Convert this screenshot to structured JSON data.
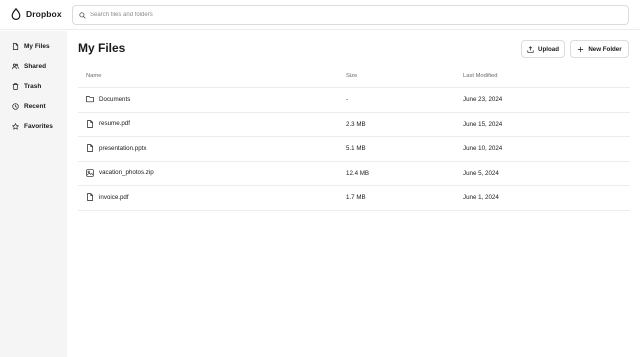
{
  "app": {
    "name": "Dropbox"
  },
  "search": {
    "placeholder": "Search files and folders",
    "value": ""
  },
  "sidebar": {
    "items": [
      {
        "label": "My Files",
        "icon": "file-icon"
      },
      {
        "label": "Shared",
        "icon": "users-icon"
      },
      {
        "label": "Trash",
        "icon": "trash-icon"
      },
      {
        "label": "Recent",
        "icon": "clock-icon"
      },
      {
        "label": "Favorites",
        "icon": "star-icon"
      }
    ]
  },
  "main": {
    "title": "My Files",
    "upload_label": "Upload",
    "new_folder_label": "New Folder",
    "columns": {
      "name": "Name",
      "size": "Size",
      "modified": "Last Modified"
    },
    "files": [
      {
        "name": "Documents",
        "size": "-",
        "modified": "June 23, 2024",
        "icon": "folder-icon"
      },
      {
        "name": "resume.pdf",
        "size": "2.3 MB",
        "modified": "June 15, 2024",
        "icon": "file-icon"
      },
      {
        "name": "presentation.pptx",
        "size": "5.1 MB",
        "modified": "June 10, 2024",
        "icon": "file-icon"
      },
      {
        "name": "vacation_photos.zip",
        "size": "12.4 MB",
        "modified": "June 5, 2024",
        "icon": "image-icon"
      },
      {
        "name": "invoice.pdf",
        "size": "1.7 MB",
        "modified": "June 1, 2024",
        "icon": "file-icon"
      }
    ]
  }
}
